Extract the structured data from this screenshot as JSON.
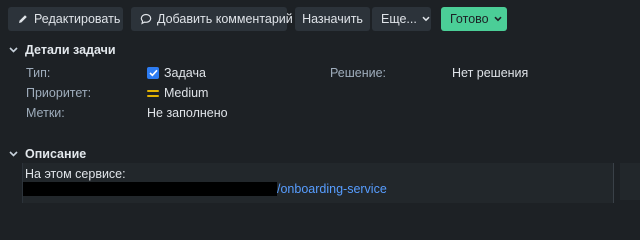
{
  "toolbar": {
    "edit_label": "Редактировать",
    "comment_label": "Добавить комментарий",
    "assign_label": "Назначить",
    "more_label": "Еще...",
    "status_label": "Готово"
  },
  "details": {
    "heading": "Детали задачи",
    "type_label": "Тип:",
    "type_value": "Задача",
    "priority_label": "Приоритет:",
    "priority_value": "Medium",
    "labels_label": "Метки:",
    "labels_value": "Не заполнено",
    "resolution_label": "Решение:",
    "resolution_value": "Нет решения"
  },
  "description": {
    "heading": "Описание",
    "line1": "На этом сервисе:",
    "link": "/onboarding-service"
  },
  "colors": {
    "background": "#1d2125",
    "status_button": "#4bce97",
    "link": "#579dff",
    "priority": "#e2b203",
    "checkbox": "#2d7cf2"
  }
}
